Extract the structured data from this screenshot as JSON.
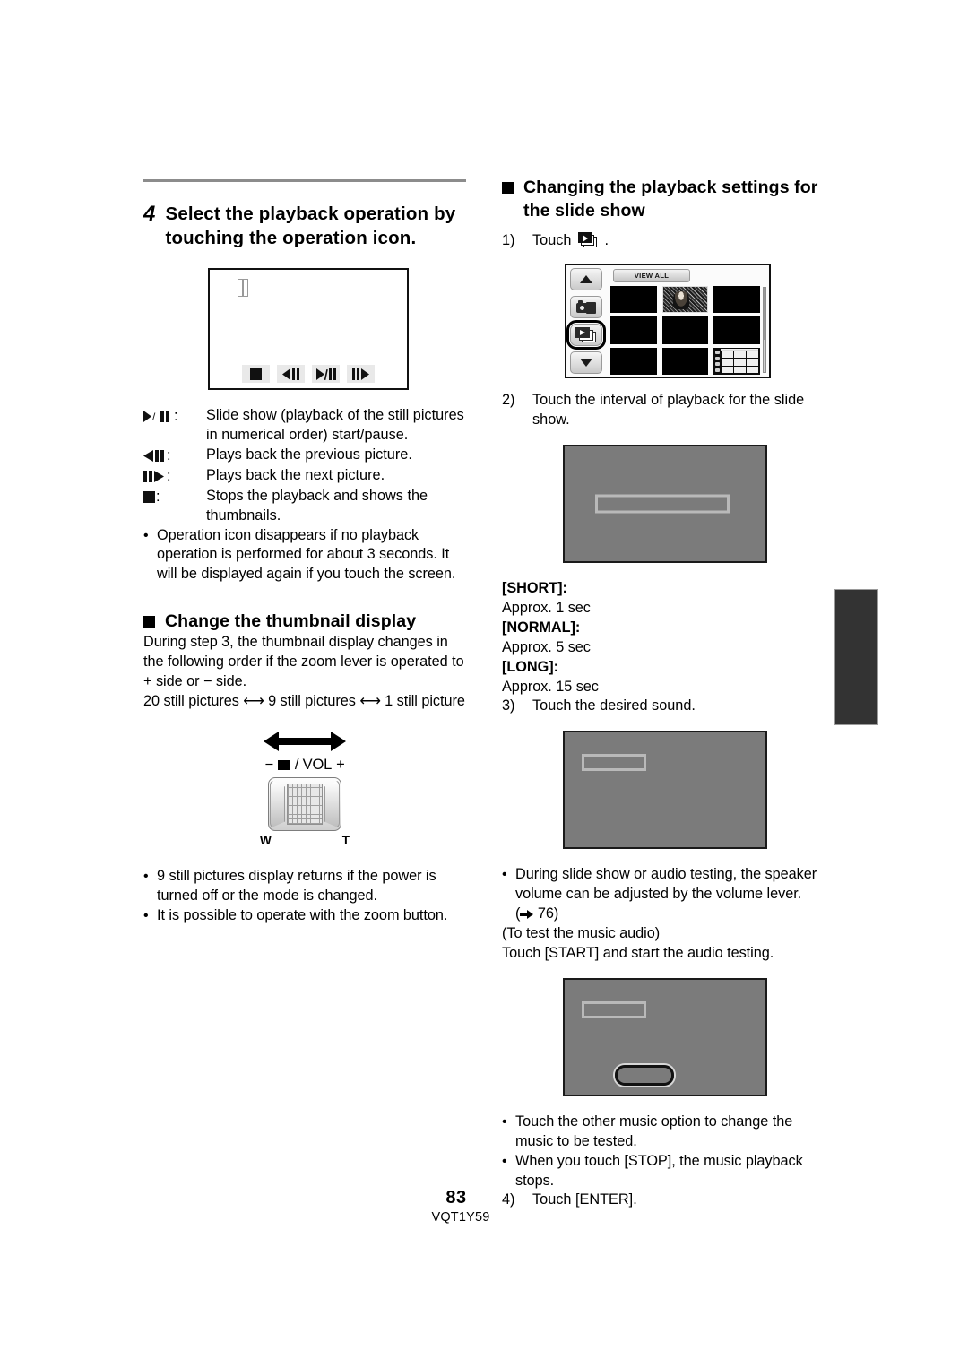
{
  "page": {
    "folio": "83",
    "part_number": "VQT1Y59"
  },
  "left_column": {
    "step": {
      "number": "4",
      "title": "Select the playback operation by touching the operation icon."
    },
    "screen_playback": {
      "name": "playback-operation-screen",
      "pause_indicator": "pause-indicator",
      "buttons": [
        {
          "icon": "stop-icon",
          "label": "Stop"
        },
        {
          "icon": "previous-picture-icon",
          "label": "Previous"
        },
        {
          "icon": "play-pause-icon",
          "label": "Play/Pause"
        },
        {
          "icon": "next-picture-icon",
          "label": "Next"
        }
      ]
    },
    "icon_legend": [
      {
        "key": "play-pause",
        "key_text": "/ :",
        "desc": "Slide show (playback of the still pictures in numerical order) start/pause."
      },
      {
        "key": "previous",
        "key_text": ":",
        "desc": "Plays back the previous picture."
      },
      {
        "key": "next",
        "key_text": ":",
        "desc": "Plays back the next picture."
      },
      {
        "key": "stop",
        "key_text": ":",
        "desc": "Stops the playback and shows the thumbnails."
      }
    ],
    "note_operation_icon": "Operation icon disappears if no playback operation is performed for about 3 seconds. It will be displayed again if you touch the screen.",
    "section_thumbnail": {
      "heading": "Change the thumbnail display",
      "body_1": "During step 3, the thumbnail display changes in the following order if the zoom lever is operated to",
      "body_plus": "+",
      "body_2": "side or",
      "body_minus": "−",
      "body_3": "side.",
      "order_line": "20 still pictures ⟷ 9 still pictures ⟷ 1 still picture",
      "lever": {
        "label_minus": "−",
        "label_icon": "thumbnail-grid-icon",
        "label_text": "/ VOL",
        "label_plus": "+",
        "wide_label": "W",
        "tele_label": "T"
      },
      "notes": [
        "9 still pictures display returns if the power is turned off or the mode is changed.",
        "It is possible to operate with the zoom button."
      ]
    }
  },
  "right_column": {
    "section_playback_settings": {
      "heading": "Changing the playback settings for the slide show",
      "step1": {
        "number": "1)",
        "text_before": "Touch",
        "icon": "slideshow-stack-icon",
        "text_after": "."
      },
      "thumbnail_screen": {
        "name": "thumbnail-list-screen",
        "view_all_label": "VIEW ALL",
        "up_button": "scroll-up-icon",
        "down_button": "scroll-down-icon",
        "photo_mode_button": "photo-mode-icon",
        "slideshow_button": "slideshow-stack-icon",
        "scrollbar": "vertical-scrollbar"
      },
      "step2": {
        "number": "2)",
        "text": "Touch the interval of playback for the slide show."
      },
      "intervals": [
        {
          "label": "[SHORT]:",
          "value": "Approx. 1 sec"
        },
        {
          "label": "[NORMAL]:",
          "value": "Approx. 5 sec"
        },
        {
          "label": "[LONG]:",
          "value": "Approx. 15 sec"
        }
      ],
      "step3": {
        "number": "3)",
        "text": "Touch the desired sound."
      },
      "note_volume": "During slide show or audio testing, the speaker volume can be adjusted by the volume lever.",
      "page_ref_open": "(",
      "page_ref_number": "76",
      "page_ref_close": ")",
      "test_heading": "(To test the music audio)",
      "test_line": "Touch [START] and start the audio testing.",
      "notes_after": [
        "Touch the other music option to change the music to be tested.",
        "When you touch [STOP], the music playback stops."
      ],
      "step4": {
        "number": "4)",
        "text": "Touch [ENTER]."
      }
    }
  }
}
